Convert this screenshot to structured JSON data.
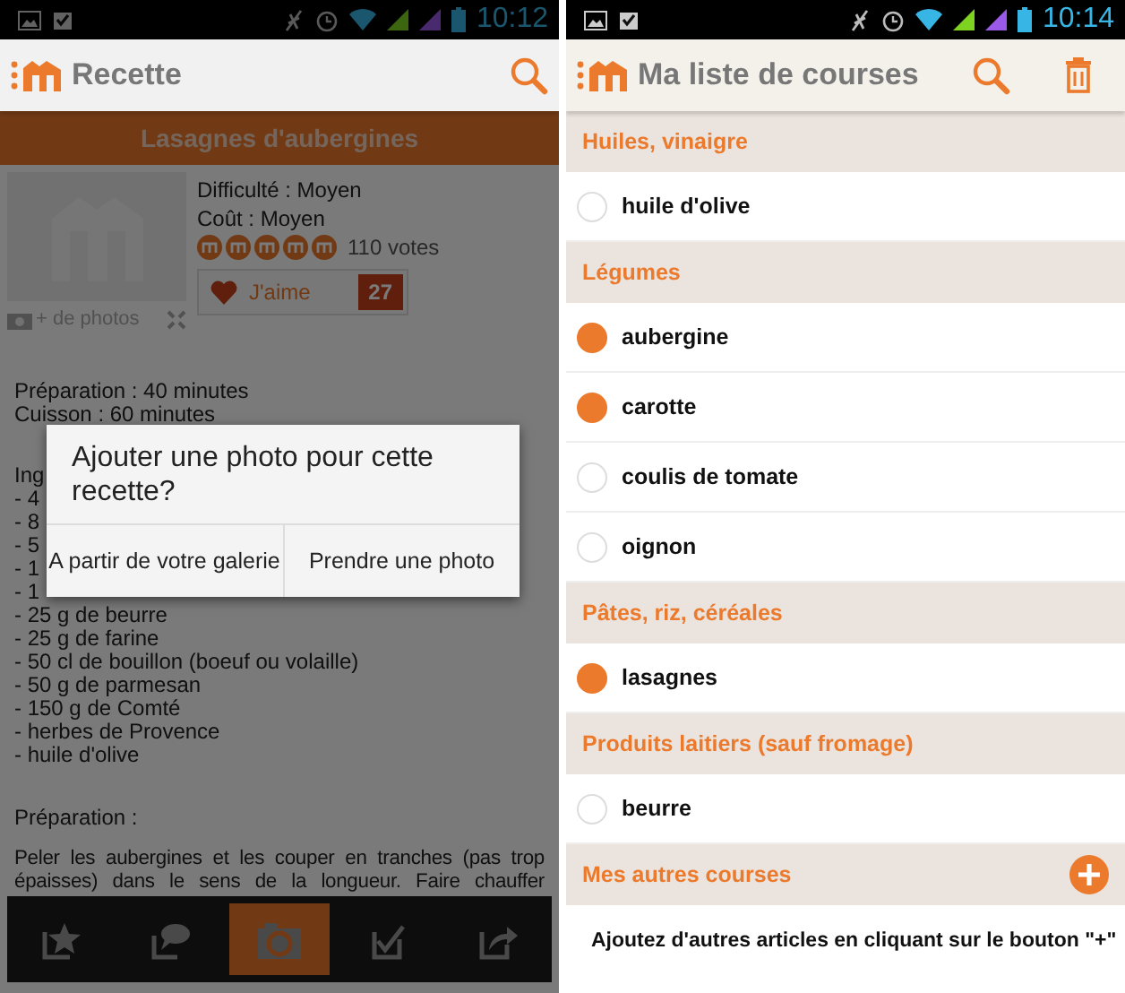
{
  "recipe_screen": {
    "status_bar": {
      "time": "10:12"
    },
    "action_bar": {
      "title": "Recette"
    },
    "recipe": {
      "title": "Lasagnes d'aubergines",
      "photo_link": "+ de photos",
      "difficulty": "Difficulté : Moyen",
      "cost": "Coût : Moyen",
      "stars": 5,
      "votes": "110 votes",
      "like": {
        "label": "J'aime",
        "count": "27"
      }
    },
    "body": {
      "times": [
        "Préparation : 40 minutes",
        "Cuisson : 60 minutes"
      ],
      "ingredients": [
        "Ing",
        "- 4",
        "- 8",
        "- 5",
        "- 1",
        "- 1",
        "- 25 g de beurre",
        "- 25 g de farine",
        "- 50 cl de bouillon (boeuf ou volaille)",
        "- 50 g de parmesan",
        "- 150 g de Comté",
        "- herbes de Provence",
        "- huile d'olive"
      ],
      "method_heading": "Préparation :",
      "method": "Peler les aubergines et les couper en tranches (pas trop épaisses) dans le sens de la longueur. Faire chauffer"
    },
    "toolbar": [
      {
        "selected": false
      },
      {
        "selected": false
      },
      {
        "selected": true
      },
      {
        "selected": false
      },
      {
        "selected": false
      }
    ],
    "dialog": {
      "title": "Ajouter une photo pour cette recette?",
      "buttons": [
        "A partir de votre galerie",
        "Prendre une photo"
      ]
    }
  },
  "list_screen": {
    "status_bar": {
      "time": "10:14"
    },
    "action_bar": {
      "title": "Ma liste de courses"
    },
    "sections": [
      {
        "heading": "Huiles, vinaigre",
        "items": [
          {
            "label": "huile d'olive",
            "checked": false
          }
        ]
      },
      {
        "heading": "Légumes",
        "items": [
          {
            "label": "aubergine",
            "checked": true
          },
          {
            "label": "carotte",
            "checked": true
          },
          {
            "label": "coulis de tomate",
            "checked": false
          },
          {
            "label": "oignon",
            "checked": false
          }
        ]
      },
      {
        "heading": "Pâtes, riz, céréales",
        "items": [
          {
            "label": "lasagnes",
            "checked": true
          }
        ]
      },
      {
        "heading": "Produits laitiers (sauf fromage)",
        "items": [
          {
            "label": "beurre",
            "checked": false
          }
        ]
      }
    ],
    "other": {
      "heading": "Mes autres courses",
      "hint": "Ajoutez d'autres articles en cliquant sur le bouton \"+\""
    }
  }
}
